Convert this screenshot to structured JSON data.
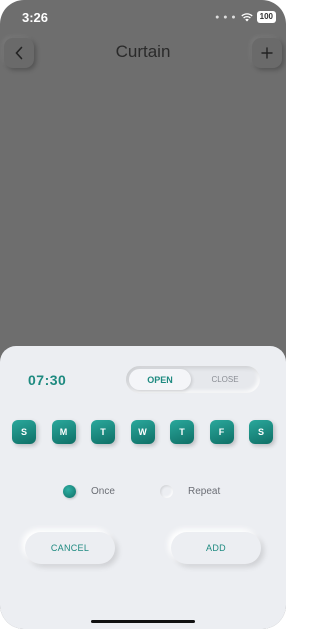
{
  "status": {
    "time": "3:26",
    "battery": "100"
  },
  "header": {
    "title": "Curtain",
    "back_icon": "chevron-left-icon",
    "add_icon": "plus-icon"
  },
  "sheet": {
    "time": "07:30",
    "toggle": {
      "open_label": "OPEN",
      "close_label": "CLOSE",
      "selected": "OPEN"
    },
    "days": [
      "S",
      "M",
      "T",
      "W",
      "T",
      "F",
      "S"
    ],
    "options": [
      {
        "label": "Once",
        "selected": true
      },
      {
        "label": "Repeat",
        "selected": false
      }
    ],
    "cancel_label": "CANCEL",
    "add_label": "ADD"
  },
  "colors": {
    "accent": "#1e8a80",
    "sheet_bg": "#eceef2",
    "overlay": "#6e6e6e"
  }
}
